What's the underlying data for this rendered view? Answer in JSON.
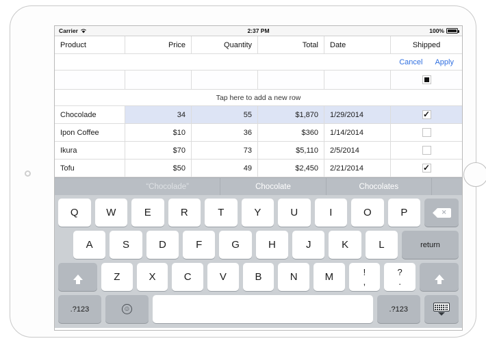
{
  "status_bar": {
    "carrier": "Carrier",
    "wifi_icon": "wifi-icon",
    "time": "2:37 PM",
    "battery_percent": "100%",
    "battery_icon": "battery-full-icon"
  },
  "table": {
    "columns": [
      "Product",
      "Price",
      "Quantity",
      "Total",
      "Date",
      "Shipped"
    ],
    "edit_actions": {
      "cancel": "Cancel",
      "apply": "Apply"
    },
    "edit_row": {
      "product": "",
      "price": "",
      "quantity": "",
      "total": "",
      "date": "",
      "shipped_state": "indeterminate"
    },
    "add_row_label": "Tap here to add a new row",
    "rows": [
      {
        "product": "Chocolade",
        "price": "34",
        "quantity": "55",
        "total": "$1,870",
        "date": "1/29/2014",
        "shipped": true,
        "selected": true,
        "editing_cell": "product"
      },
      {
        "product": "Ipon Coffee",
        "price": "$10",
        "quantity": "36",
        "total": "$360",
        "date": "1/14/2014",
        "shipped": false,
        "selected": false,
        "editing_cell": ""
      },
      {
        "product": "Ikura",
        "price": "$70",
        "quantity": "73",
        "total": "$5,110",
        "date": "2/5/2014",
        "shipped": false,
        "selected": false,
        "editing_cell": ""
      },
      {
        "product": "Tofu",
        "price": "$50",
        "quantity": "49",
        "total": "$2,450",
        "date": "2/21/2014",
        "shipped": true,
        "selected": false,
        "editing_cell": ""
      }
    ]
  },
  "suggestions": [
    {
      "label": "“Chocolade”",
      "is_original": true
    },
    {
      "label": "Chocolate",
      "is_original": false
    },
    {
      "label": "Chocolates",
      "is_original": false
    }
  ],
  "keyboard": {
    "row1": [
      "Q",
      "W",
      "E",
      "R",
      "T",
      "Y",
      "U",
      "I",
      "O",
      "P"
    ],
    "row1_delete": "delete-key",
    "row2": [
      "A",
      "S",
      "D",
      "F",
      "G",
      "H",
      "J",
      "K",
      "L"
    ],
    "row2_return": "return",
    "row3": [
      "Z",
      "X",
      "C",
      "V",
      "B",
      "N",
      "M"
    ],
    "row3_punct": [
      {
        "top": "!",
        "bottom": ","
      },
      {
        "top": "?",
        "bottom": "."
      }
    ],
    "shift_left_icon": "shift-up-arrow-icon",
    "shift_right_icon": "shift-up-arrow-icon",
    "row4": {
      "numbers_left": ".?123",
      "emoji_icon": "emoji-smiley-icon",
      "space": "",
      "numbers_right": ".?123",
      "dismiss_icon": "keyboard-dismiss-icon"
    }
  },
  "colors": {
    "accent_link": "#2f6fe0",
    "selection_row": "#dde4f5",
    "keyboard_bg": "#ccd0d4",
    "key_gray": "#b4b9bf",
    "suggestion_bar": "#b9bec4"
  }
}
